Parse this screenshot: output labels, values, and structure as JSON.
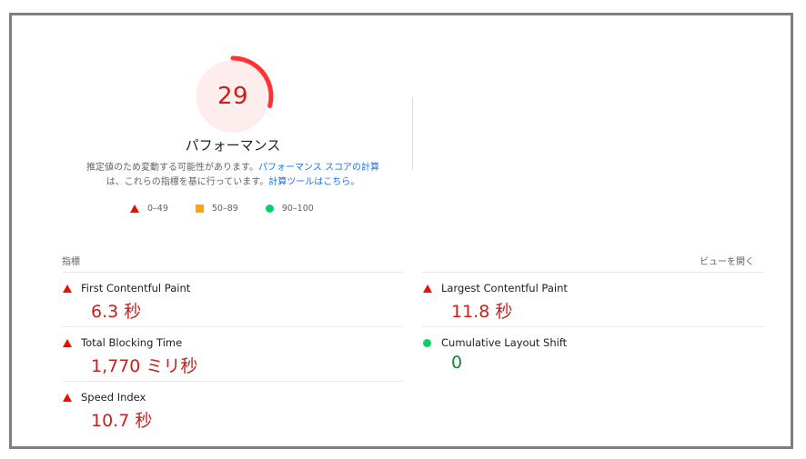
{
  "score": {
    "value": "29",
    "fraction": 0.29,
    "title": "パフォーマンス"
  },
  "description": {
    "text1": "推定値のため変動する可能性があります。",
    "link1": "パフォーマンス スコアの計算",
    "text2": "は、これらの指標を基に行っています。",
    "link2": "計算ツールはこちら。"
  },
  "legend": [
    {
      "shape": "triangle-icon",
      "label": "0–49",
      "color": "#eb0f00"
    },
    {
      "shape": "square-icon",
      "label": "50–89",
      "color": "#ffa400"
    },
    {
      "shape": "circle-icon",
      "label": "90–100",
      "color": "#0cce6b"
    }
  ],
  "metrics_header": {
    "label": "指標",
    "expand": "ビューを開く"
  },
  "metrics": {
    "fcp": {
      "name": "First Contentful Paint",
      "value": "6.3 秒",
      "status": "bad"
    },
    "lcp": {
      "name": "Largest Contentful Paint",
      "value": "11.8 秒",
      "status": "bad"
    },
    "tbt": {
      "name": "Total Blocking Time",
      "value": "1,770 ミリ秒",
      "status": "bad"
    },
    "cls": {
      "name": "Cumulative Layout Shift",
      "value": "0",
      "status": "good"
    },
    "si": {
      "name": "Speed Index",
      "value": "10.7 秒",
      "status": "bad"
    }
  },
  "colors": {
    "fail": "#eb0f00",
    "fail_text": "#c5221f",
    "pass": "#0cce6b",
    "pass_text": "#188038",
    "link": "#1a73e8"
  }
}
